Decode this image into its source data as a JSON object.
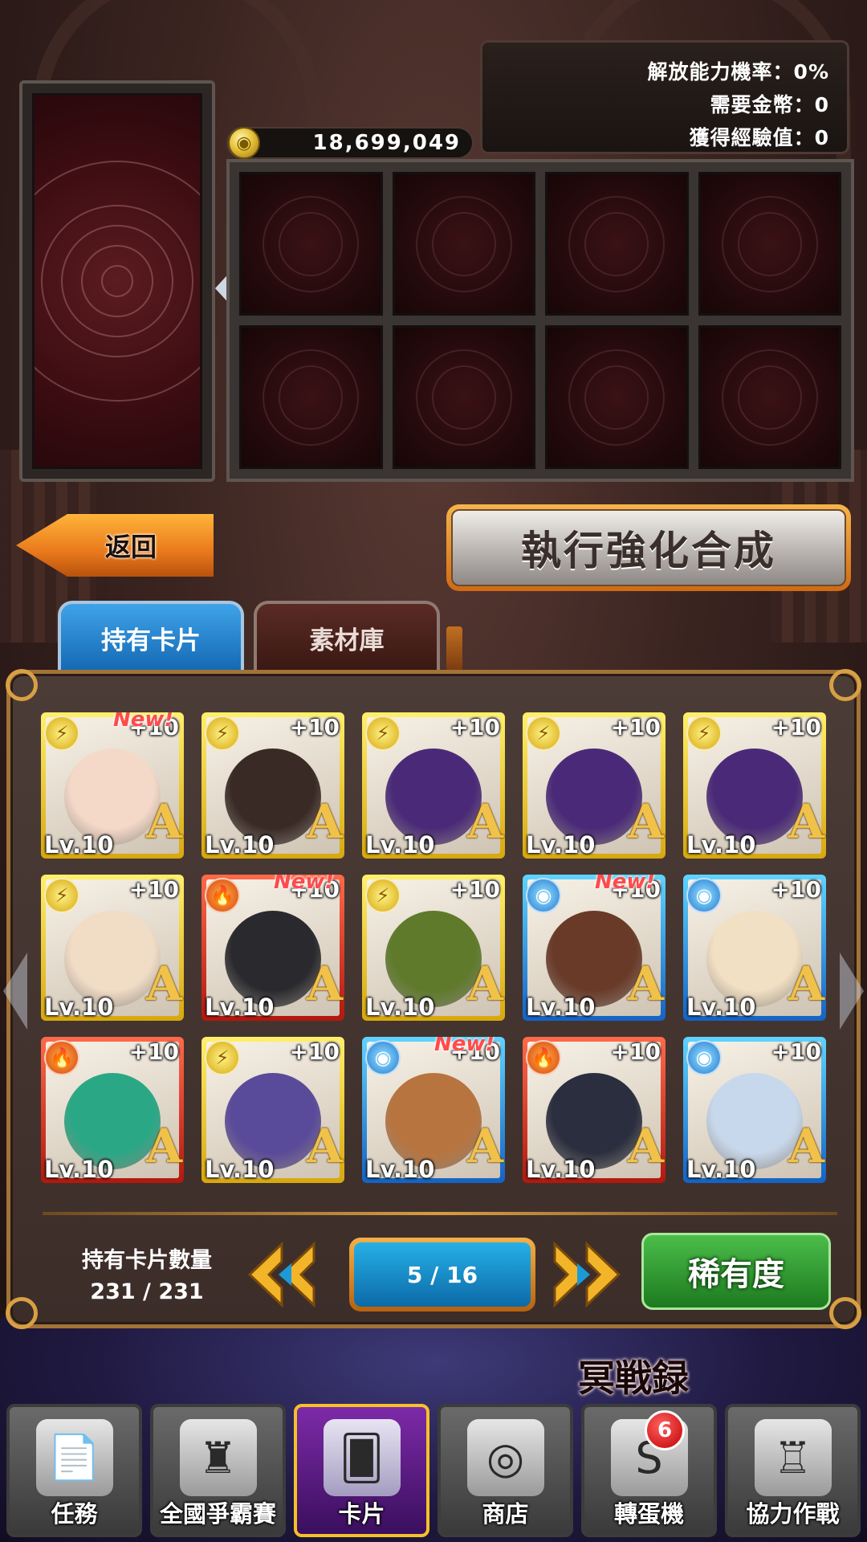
{
  "info": {
    "release_rate": "解放能力機率：0%",
    "required_coins": "需要金幣：0",
    "gained_exp": "獲得經驗值：0"
  },
  "coins": {
    "value": "18,699,049",
    "icon": "coin-icon"
  },
  "material_slots": 8,
  "buttons": {
    "back": "返回",
    "execute": "執行強化合成",
    "rarity": "稀有度"
  },
  "tabs": [
    {
      "label": "持有卡片"
    },
    {
      "label": "素材庫"
    }
  ],
  "cards": [
    {
      "element": "thunder",
      "plus": "+10",
      "level": "Lv.10",
      "rank": "A",
      "new": "New!",
      "portrait": "#f4d9c8"
    },
    {
      "element": "thunder",
      "plus": "+10",
      "level": "Lv.10",
      "rank": "A",
      "new": "",
      "portrait": "#3a2a26"
    },
    {
      "element": "thunder",
      "plus": "+10",
      "level": "Lv.10",
      "rank": "A",
      "new": "",
      "portrait": "#4a2a78"
    },
    {
      "element": "thunder",
      "plus": "+10",
      "level": "Lv.10",
      "rank": "A",
      "new": "",
      "portrait": "#4a2a78"
    },
    {
      "element": "thunder",
      "plus": "+10",
      "level": "Lv.10",
      "rank": "A",
      "new": "",
      "portrait": "#4a2a78"
    },
    {
      "element": "thunder",
      "plus": "+10",
      "level": "Lv.10",
      "rank": "A",
      "new": "",
      "portrait": "#f1dcc6"
    },
    {
      "element": "fire",
      "plus": "+10",
      "level": "Lv.10",
      "rank": "A",
      "new": "New!",
      "portrait": "#2a2a2e"
    },
    {
      "element": "thunder",
      "plus": "+10",
      "level": "Lv.10",
      "rank": "A",
      "new": "",
      "portrait": "#5e7a2a"
    },
    {
      "element": "water",
      "plus": "+10",
      "level": "Lv.10",
      "rank": "A",
      "new": "New!",
      "portrait": "#6a3a28"
    },
    {
      "element": "water",
      "plus": "+10",
      "level": "Lv.10",
      "rank": "A",
      "new": "",
      "portrait": "#f2e0c4"
    },
    {
      "element": "fire",
      "plus": "+10",
      "level": "Lv.10",
      "rank": "A",
      "new": "",
      "portrait": "#2aa886"
    },
    {
      "element": "thunder",
      "plus": "+10",
      "level": "Lv.10",
      "rank": "A",
      "new": "",
      "portrait": "#5a4a9a"
    },
    {
      "element": "water",
      "plus": "+10",
      "level": "Lv.10",
      "rank": "A",
      "new": "New!",
      "portrait": "#b8743e"
    },
    {
      "element": "fire",
      "plus": "+10",
      "level": "Lv.10",
      "rank": "A",
      "new": "",
      "portrait": "#2a2e3e"
    },
    {
      "element": "water",
      "plus": "+10",
      "level": "Lv.10",
      "rank": "A",
      "new": "",
      "portrait": "#c8d8ec"
    }
  ],
  "element_icons": {
    "thunder": "⚡",
    "fire": "🔥",
    "water": "◉"
  },
  "card_count": {
    "title": "持有卡片數量",
    "value": "231 / 231"
  },
  "pagination": {
    "current": 5,
    "total": 16,
    "text": "5 / 16"
  },
  "logo": "冥戦録",
  "nav": [
    {
      "label": "任務",
      "icon": "document-icon",
      "glyph": "📄",
      "active": false
    },
    {
      "label": "全國爭霸賽",
      "icon": "throne-icon",
      "glyph": "♜",
      "active": false
    },
    {
      "label": "卡片",
      "icon": "cards-icon",
      "glyph": "🂠",
      "active": true
    },
    {
      "label": "商店",
      "icon": "coins-icon",
      "glyph": "◎",
      "active": false
    },
    {
      "label": "轉蛋機",
      "icon": "gacha-icon",
      "glyph": "S",
      "active": false,
      "badge": "6"
    },
    {
      "label": "協力作戰",
      "icon": "castle-icon",
      "glyph": "♖",
      "active": false
    }
  ]
}
